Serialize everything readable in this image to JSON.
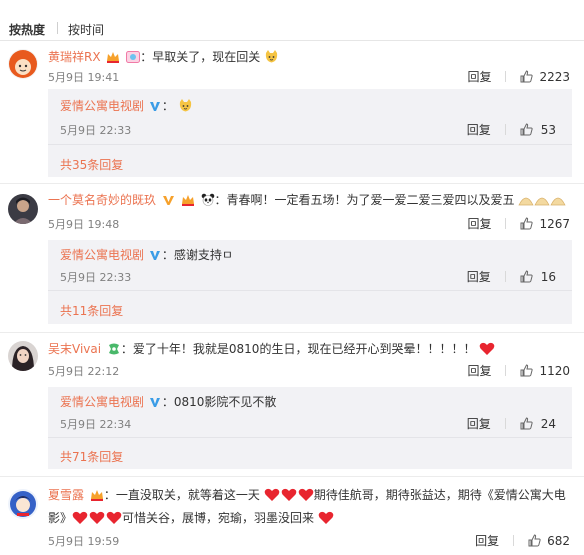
{
  "sort": {
    "tab_hot": "按热度",
    "tab_time": "按时间"
  },
  "colors": {
    "accent": "#eb7350",
    "meta": "#808080",
    "subbox": "#f2f2f5",
    "heart": "#e8252f"
  },
  "comments": [
    {
      "user": "黄瑞祥RX",
      "text": "：早取关了，现在回关",
      "time": "5月9日 19:41",
      "reply_label": "回复",
      "likes": "2223",
      "avatar_icon": "orange-face-avatar",
      "sub": {
        "user": "爱情公寓电视剧",
        "text": "：",
        "time": "5月9日 22:33",
        "reply_label": "回复",
        "likes": "53",
        "more": "共35条回复"
      }
    },
    {
      "user": "一个莫名奇妙的既玖",
      "text": "：青春啊！一定看五场！为了爱一爱二爱三爱四以及爱五",
      "time": "5月9日 19:48",
      "reply_label": "回复",
      "likes": "1267",
      "avatar_icon": "dark-photo-avatar",
      "sub": {
        "user": "爱情公寓电视剧",
        "text": "：感谢支持ㅁ",
        "time": "5月9日 22:33",
        "reply_label": "回复",
        "likes": "16",
        "more": "共11条回复"
      }
    },
    {
      "user": "吴末Vivai",
      "text": "：爱了十年！我就是0810的生日，现在已经开心到哭晕！！！！！",
      "time": "5月9日 22:12",
      "reply_label": "回复",
      "likes": "1120",
      "avatar_icon": "girl-photo-avatar",
      "sub": {
        "user": "爱情公寓电视剧",
        "text": "：0810影院不见不散",
        "time": "5月9日 22:34",
        "reply_label": "回复",
        "likes": "24",
        "more": "共71条回复"
      }
    },
    {
      "user": "夏雪露",
      "text_part1": "：一直没取关，就等着这一天",
      "text_part2": "期待佳航哥，期待张益达，期待《爱情公寓大电",
      "text_part3": "影》",
      "text_part4": "可惜关谷，展博，宛瑜，羽墨没回来",
      "time": "5月9日 19:59",
      "reply_label": "回复",
      "likes": "682",
      "avatar_icon": "blue-cartoon-avatar"
    }
  ]
}
